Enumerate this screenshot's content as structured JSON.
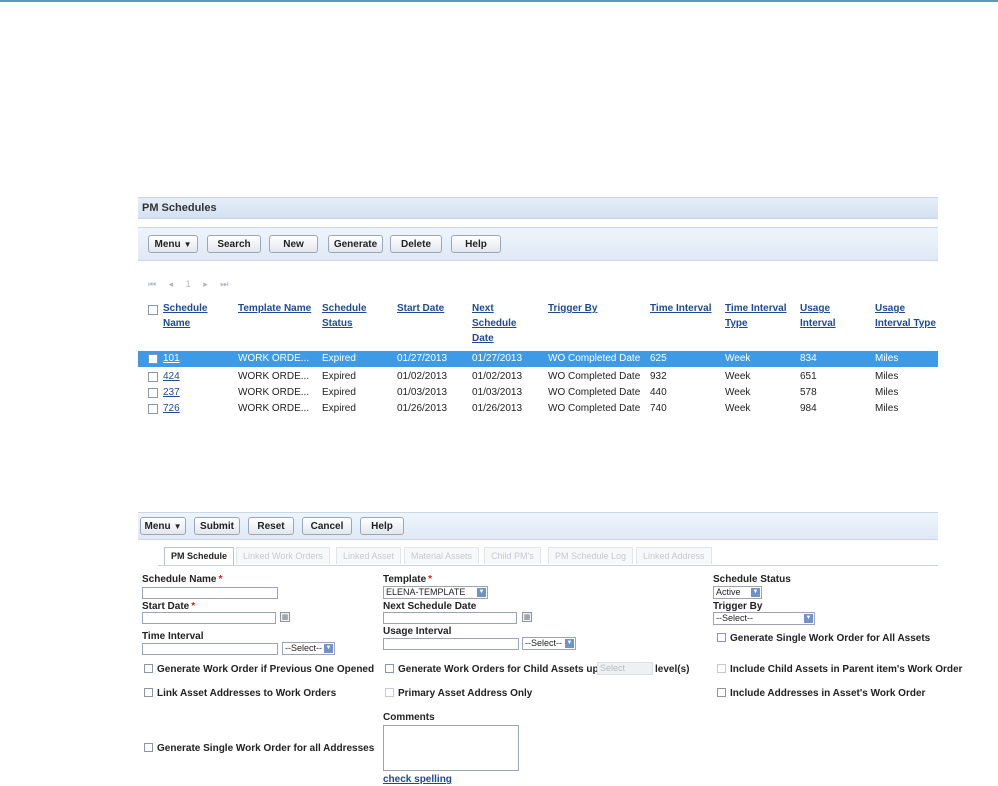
{
  "list": {
    "title": "PM Schedules",
    "toolbar": {
      "menu": "Menu",
      "search": "Search",
      "new": "New",
      "generate": "Generate",
      "delete": "Delete",
      "help": "Help"
    },
    "pager": {
      "first": "⏮",
      "prev": "◂",
      "page": "1",
      "next": "▸",
      "last": "⏭"
    },
    "columns": [
      "Schedule Name",
      "Template Name",
      "Schedule Status",
      "Start Date",
      "Next Schedule Date",
      "Trigger By",
      "Time Interval",
      "Time Interval Type",
      "Usage Interval",
      "Usage Interval Type"
    ],
    "rows": [
      {
        "name": "101",
        "template": "WORK ORDE...",
        "status": "Expired",
        "start": "01/27/2013",
        "next": "01/27/2013",
        "trigger": "WO Completed Date",
        "time_interval": "625",
        "time_type": "Week",
        "usage_interval": "834",
        "usage_type": "Miles"
      },
      {
        "name": "424",
        "template": "WORK ORDE...",
        "status": "Expired",
        "start": "01/02/2013",
        "next": "01/02/2013",
        "trigger": "WO Completed Date",
        "time_interval": "932",
        "time_type": "Week",
        "usage_interval": "651",
        "usage_type": "Miles"
      },
      {
        "name": "237",
        "template": "WORK ORDE...",
        "status": "Expired",
        "start": "01/03/2013",
        "next": "01/03/2013",
        "trigger": "WO Completed Date",
        "time_interval": "440",
        "time_type": "Week",
        "usage_interval": "578",
        "usage_type": "Miles"
      },
      {
        "name": "726",
        "template": "WORK ORDE...",
        "status": "Expired",
        "start": "01/26/2013",
        "next": "01/26/2013",
        "trigger": "WO Completed Date",
        "time_interval": "740",
        "time_type": "Week",
        "usage_interval": "984",
        "usage_type": "Miles"
      }
    ]
  },
  "form": {
    "toolbar": {
      "menu": "Menu",
      "submit": "Submit",
      "reset": "Reset",
      "cancel": "Cancel",
      "help": "Help"
    },
    "tabs": [
      "PM Schedule",
      "Linked Work Orders",
      "Linked Asset",
      "Material Assets",
      "Child PM's",
      "PM Schedule Log",
      "Linked Address"
    ],
    "fields": {
      "schedule_name": {
        "label": "Schedule Name",
        "value": ""
      },
      "template": {
        "label": "Template",
        "value": "ELENA-TEMPLATE"
      },
      "schedule_status": {
        "label": "Schedule Status",
        "value": "Active"
      },
      "start_date": {
        "label": "Start Date",
        "value": ""
      },
      "next_schedule_date": {
        "label": "Next Schedule Date",
        "value": ""
      },
      "trigger_by": {
        "label": "Trigger By",
        "value": "--Select--"
      },
      "time_interval": {
        "label": "Time Interval",
        "value": "",
        "unit": "--Select--"
      },
      "usage_interval": {
        "label": "Usage Interval",
        "value": "",
        "unit": "--Select--"
      },
      "comments": {
        "label": "Comments",
        "value": ""
      }
    },
    "checkboxes": {
      "single_wo_all_assets": "Generate Single Work Order for All Assets",
      "wo_if_previous_opened": "Generate Work Order if Previous One Opened",
      "wo_child_assets_up_to": "Generate Work Orders for Child Assets up to",
      "levels_select": "Select",
      "levels_suffix": "level(s)",
      "include_child_assets": "Include Child Assets in Parent item's Work Order",
      "link_asset_addresses": "Link Asset Addresses to Work Orders",
      "primary_asset_address": "Primary Asset Address Only",
      "include_addresses": "Include Addresses in Asset's Work Order",
      "single_wo_all_addresses": "Generate Single Work Order for all Addresses"
    },
    "check_spelling": "check spelling"
  }
}
